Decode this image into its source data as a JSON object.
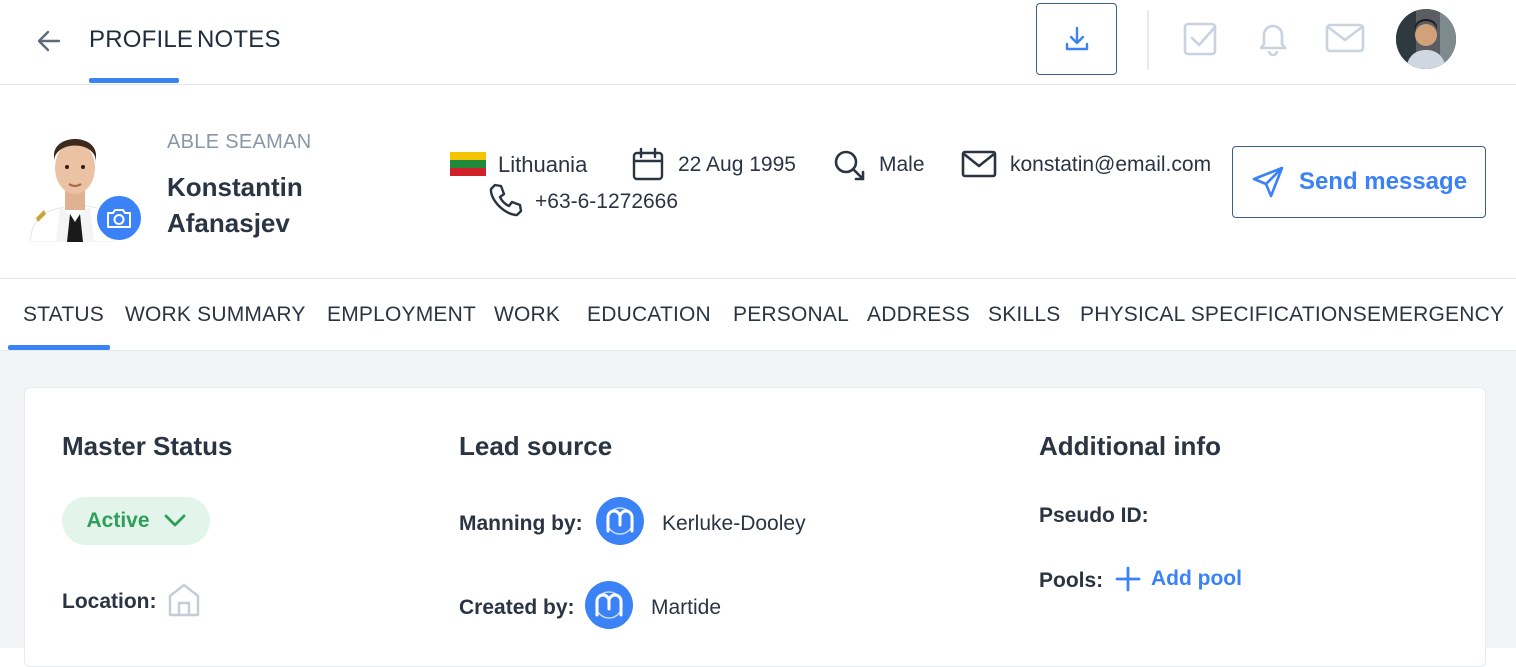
{
  "header": {
    "tabs": [
      {
        "label": "PROFILE",
        "active": true
      },
      {
        "label": "NOTES",
        "active": false
      }
    ],
    "icons": [
      "back-arrow-icon",
      "download-icon",
      "checkbox-icon",
      "bell-icon",
      "mail-icon"
    ],
    "accent": "#3b82f6"
  },
  "profile": {
    "rank": "ABLE SEAMAN",
    "first_name": "Konstantin",
    "last_name": "Afanasjev",
    "country": "Lithuania",
    "dob": "22 Aug 1995",
    "gender": "Male",
    "email": "konstatin@email.com",
    "phone": "+63-6-1272666",
    "send_label": "Send message"
  },
  "tabs": [
    {
      "label": "STATUS",
      "active": true
    },
    {
      "label": "WORK SUMMARY"
    },
    {
      "label": "EMPLOYMENT"
    },
    {
      "label": "WORK"
    },
    {
      "label": "EDUCATION"
    },
    {
      "label": "PERSONAL"
    },
    {
      "label": "ADDRESS"
    },
    {
      "label": "SKILLS"
    },
    {
      "label": "PHYSICAL SPECIFICATIONS"
    },
    {
      "label": "EMERGENCY"
    }
  ],
  "status_card": {
    "master_status": {
      "title": "Master Status",
      "status": "Active",
      "status_color": "#2e9e5b",
      "location_label": "Location:"
    },
    "lead_source": {
      "title": "Lead source",
      "manning_label": "Manning by:",
      "manning_value": "Kerluke-Dooley",
      "created_label": "Created by:",
      "created_value": "Martide"
    },
    "additional_info": {
      "title": "Additional info",
      "pseudo_label": "Pseudo ID:",
      "pools_label": "Pools:",
      "add_pool_label": "Add pool"
    }
  }
}
